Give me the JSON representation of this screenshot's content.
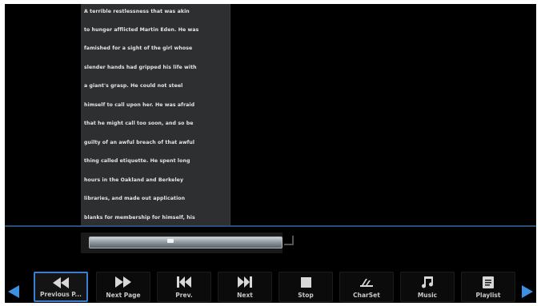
{
  "reader": {
    "lines": [
      "A terrible restlessness that was akin",
      "to hunger afflicted Martin Eden. He was",
      "famished for a sight of the girl whose",
      "slender hands had gripped his life with",
      "a giant's grasp. He could not steel",
      "himself to call upon her. He was afraid",
      "that he might call too soon, and so be",
      "guilty of an awful breach of that awful",
      "thing called etiquette. He spent long",
      "hours in the Oakland and Berkeley",
      "libraries, and made out application",
      "blanks for membership for himself, his"
    ]
  },
  "progress": {
    "fraction": 0.42
  },
  "controls": [
    {
      "label": "Previous P...",
      "icon": "rewind-icon"
    },
    {
      "label": "Next Page",
      "icon": "fast-forward-icon"
    },
    {
      "label": "Prev.",
      "icon": "skip-previous-icon"
    },
    {
      "label": "Next",
      "icon": "skip-next-icon"
    },
    {
      "label": "Stop",
      "icon": "stop-icon"
    },
    {
      "label": "CharSet",
      "icon": "charset-icon"
    },
    {
      "label": "Music",
      "icon": "music-note-icon"
    },
    {
      "label": "Playlist",
      "icon": "playlist-icon"
    }
  ],
  "colors": {
    "accent": "#3a7fd0",
    "nav_arrow": "#3d8fe2",
    "divider": "#2a4f78"
  }
}
